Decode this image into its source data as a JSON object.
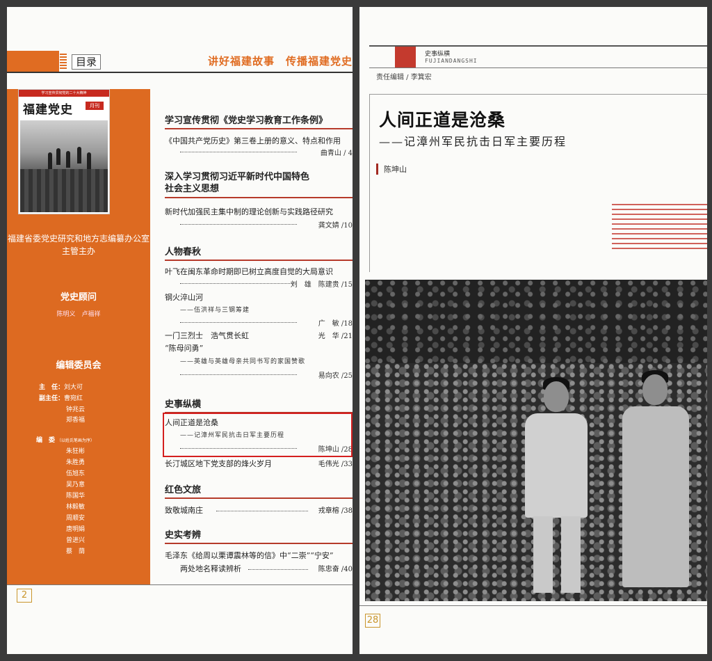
{
  "left_page": {
    "menu_label": "目录",
    "slogan": "讲好福建故事　传播福建党史",
    "cover": {
      "strip_text": "学习宣传贯彻党的二十大精神",
      "title": "福建党史",
      "badge": "月刊"
    },
    "sidebar": {
      "org_line1": "福建省委党史研究和地方志编纂办公室",
      "org_line2": "主管主办",
      "advisor_heading": "党史顾问",
      "advisor_names": "陈明义　卢福祥",
      "committee_heading": "编辑委员会",
      "director_label": "主　任：",
      "director": "刘大可",
      "deputy_label": "副主任：",
      "deputies": [
        "曹宛红",
        "钟兆云",
        "郑香福"
      ],
      "editors_label": "编　委",
      "editors_note": "（以姓氏笔画为序）",
      "editors": [
        "朱狂彬",
        "朱胜勇",
        "伍旭东",
        "吴乃意",
        "陈国华",
        "林毅敏",
        "周顺安",
        "唐明娟",
        "曾进兴",
        "蔡　荫"
      ]
    },
    "toc": [
      {
        "section": "学习宣传贯彻《党史学习教育工作条例》",
        "title": "《中国共产党历史》第三卷上册的意义、特点和作用",
        "author_page": "曲青山 / 4"
      },
      {
        "section_line1": "深入学习贯彻习近平新时代中国特色",
        "section_line2": "社会主义思想",
        "title": "新时代加强民主集中制的理论创新与实践路径研究",
        "author_page": "龚文婧 /10"
      },
      {
        "section": "人物春秋",
        "items": [
          {
            "title": "叶飞在闽东革命时期即已树立高度自觉的大局意识",
            "author_page": "刘　雄　陈建贵 /15"
          },
          {
            "title": "钢火淬山河",
            "subtitle": "——伍洪祥与三钢筹建",
            "author_page": "广　敏 /18"
          },
          {
            "title": "一门三烈士　浩气贯长虹",
            "author_page": "光　华 /21"
          },
          {
            "title": "“陈母问勇”",
            "subtitle": "——英雄与英雄母亲共同书写的家国赞歌",
            "author_page": "易向农 /25"
          }
        ]
      },
      {
        "section": "史事纵横",
        "items": [
          {
            "title": "人间正道是沧桑",
            "subtitle": "——记漳州军民抗击日军主要历程",
            "author_page": "陈坤山 /28"
          },
          {
            "title": "长汀城区地下党支部的烽火岁月",
            "author_page": "毛伟光 /33"
          }
        ]
      },
      {
        "section": "红色文旅",
        "title": "致敬城南庄",
        "author_page": "戎章榕 /38"
      },
      {
        "section": "史实考辨",
        "title": "毛泽东《给周以栗谭震林等的信》中“二崇”“宁安”",
        "title2": "两处地名释读辨析",
        "author_page": "陈忠奋 /40"
      }
    ],
    "page_number": "2"
  },
  "right_page": {
    "column_name": "史事纵横",
    "column_name_en": "FUJIANDANGSHI",
    "editor": "责任编辑 / 李箕宏",
    "title": "人间正道是沧桑",
    "subtitle": "——记漳州军民抗击日军主要历程",
    "author": "陈坤山",
    "page_number": "28"
  },
  "colors": {
    "accent_orange": "#dd6a21",
    "highlight_red": "#d41f1f",
    "title_red": "#c43a2e"
  }
}
